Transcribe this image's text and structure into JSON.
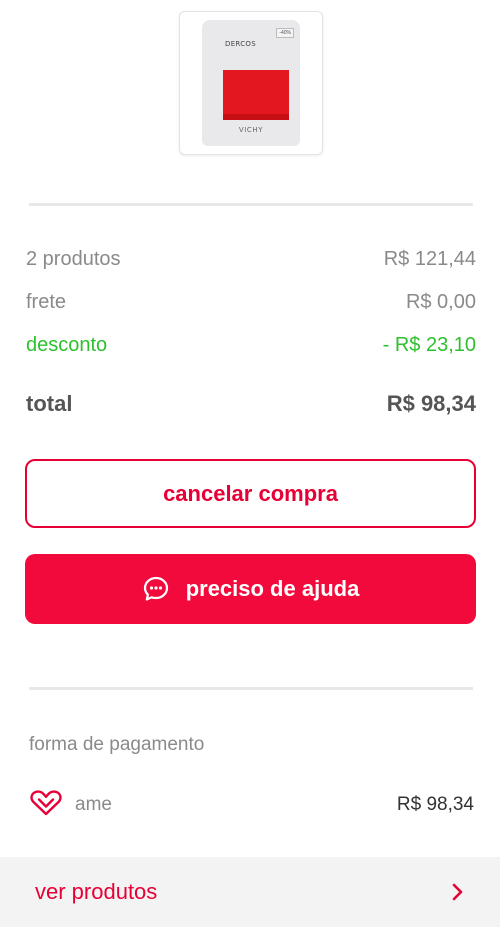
{
  "product": {
    "image_label": "product-image",
    "brand": "DERCOS",
    "maker": "VICHY",
    "badge": "-40%"
  },
  "summary": {
    "products": {
      "label": "2 produtos",
      "value": "R$ 121,44"
    },
    "shipping": {
      "label": "frete",
      "value": "R$ 0,00"
    },
    "discount": {
      "label": "desconto",
      "value": "- R$ 23,10"
    },
    "total": {
      "label": "total",
      "value": "R$ 98,34"
    }
  },
  "actions": {
    "cancel_label": "cancelar compra",
    "help_label": "preciso de ajuda",
    "help_icon": "chat-bubble-icon"
  },
  "payment": {
    "section_title": "forma de pagamento",
    "method_icon": "heart-icon",
    "method_name": "ame",
    "amount": "R$ 98,34"
  },
  "footer": {
    "label": "ver produtos",
    "icon": "chevron-right-icon"
  },
  "colors": {
    "accent": "#e60036",
    "discount": "#2dc12d",
    "muted": "#8a8a8a"
  }
}
